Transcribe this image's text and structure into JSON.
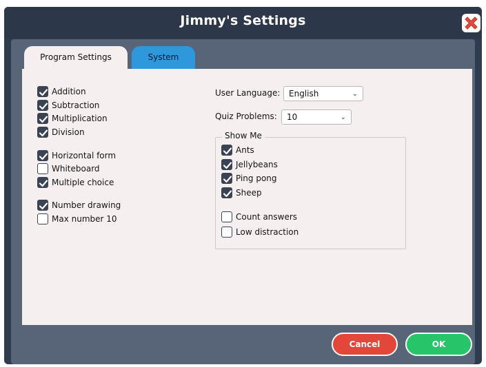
{
  "window": {
    "title": "Jimmy's Settings",
    "close_icon": "close-x-icon"
  },
  "tabs": [
    {
      "label": "Program Settings",
      "active": true
    },
    {
      "label": "System",
      "active": false
    }
  ],
  "left_options": [
    {
      "label": "Addition",
      "checked": true
    },
    {
      "label": "Subtraction",
      "checked": true
    },
    {
      "label": "Multiplication",
      "checked": true
    },
    {
      "label": "Division",
      "checked": true
    },
    {
      "label": "Horizontal form",
      "checked": true
    },
    {
      "label": "Whiteboard",
      "checked": false
    },
    {
      "label": "Multiple choice",
      "checked": true
    },
    {
      "label": "Number drawing",
      "checked": true
    },
    {
      "label": "Max number 10",
      "checked": false
    }
  ],
  "user_language": {
    "label": "User Language:",
    "value": "English"
  },
  "quiz_problems": {
    "label": "Quiz Problems:",
    "value": "10"
  },
  "show_me": {
    "legend": "Show Me",
    "options": [
      {
        "label": "Ants",
        "checked": true
      },
      {
        "label": "Jellybeans",
        "checked": true
      },
      {
        "label": "Ping pong",
        "checked": true
      },
      {
        "label": "Sheep",
        "checked": true
      },
      {
        "label": "Count answers",
        "checked": false
      },
      {
        "label": "Low distraction",
        "checked": false
      }
    ]
  },
  "buttons": {
    "cancel": "Cancel",
    "ok": "OK"
  },
  "colors": {
    "window_bg": "#2f3b4e",
    "panel_bg": "#586478",
    "content_bg": "#f5efef",
    "active_tab": "#f5efef",
    "system_tab": "#2f97dc",
    "close_red": "#e24a3b",
    "cancel_red": "#e3473a",
    "ok_green": "#28c46a",
    "checkbox_fill": "#3a4354"
  }
}
